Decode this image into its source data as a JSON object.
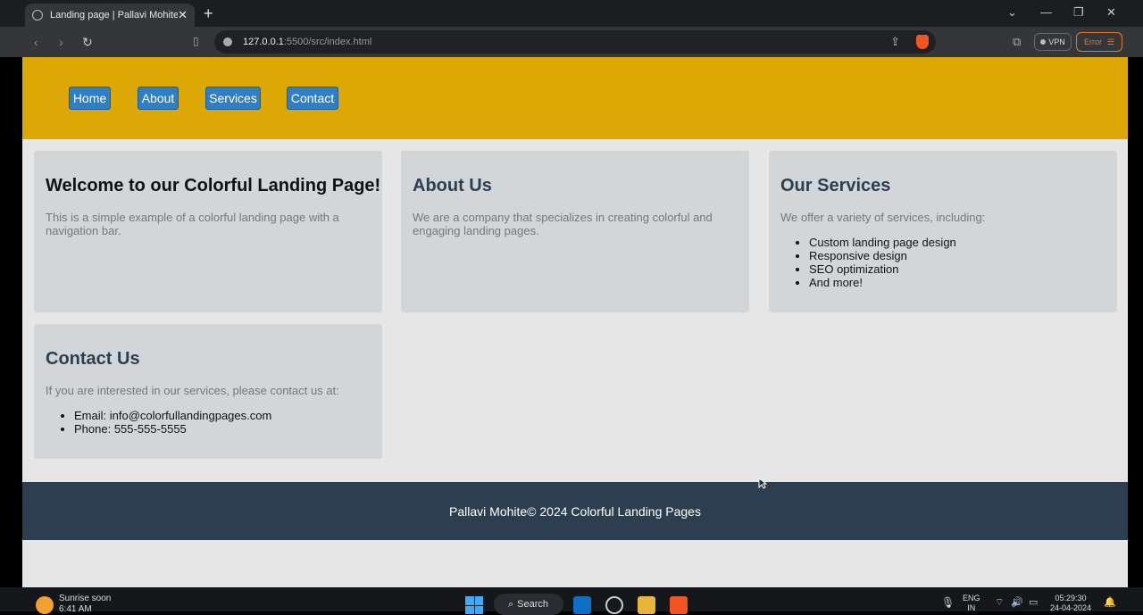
{
  "browser": {
    "tab_title": "Landing page | Pallavi Mohite",
    "url_host": "127.0.0.1",
    "url_rest": ":5500/src/index.html",
    "vpn_label": "VPN",
    "error_label": "Error"
  },
  "nav": {
    "items": [
      "Home",
      "About",
      "Services",
      "Contact"
    ]
  },
  "cards": {
    "welcome": {
      "title": "Welcome to our Colorful Landing Page!",
      "text": "This is a simple example of a colorful landing page with a navigation bar."
    },
    "about": {
      "title": "About Us",
      "text": "We are a company that specializes in creating colorful and engaging landing pages."
    },
    "services": {
      "title": "Our Services",
      "text": "We offer a variety of services, including:",
      "items": [
        "Custom landing page design",
        "Responsive design",
        "SEO optimization",
        "And more!"
      ]
    },
    "contact": {
      "title": "Contact Us",
      "text": "If you are interested in our services, please contact us at:",
      "items": [
        "Email: info@colorfullandingpages.com",
        "Phone: 555-555-5555"
      ]
    }
  },
  "footer": {
    "text": "Pallavi Mohite© 2024 Colorful Landing Pages"
  },
  "taskbar": {
    "weather_line1": "Sunrise soon",
    "weather_line2": "6:41 AM",
    "search_label": "Search",
    "lang_line1": "ENG",
    "lang_line2": "IN",
    "time": "05:29:30",
    "date": "24-04-2024"
  },
  "colors": {
    "header_bg": "#dda806",
    "nav_button": "#2f7fc2",
    "card_bg": "#d3d6d8",
    "footer_bg": "#2c3e50",
    "page_bg": "#e6e6e6"
  },
  "icons": [
    "globe-icon",
    "close-icon",
    "plus-icon",
    "back-icon",
    "forward-icon",
    "reload-icon",
    "bookmark-icon",
    "info-icon",
    "share-icon",
    "brave-icon",
    "extensions-icon",
    "menu-icon",
    "windows-start-icon",
    "search-icon",
    "vscode-icon",
    "chrome-icon",
    "folder-icon",
    "mic-icon",
    "wifi-icon",
    "volume-icon",
    "battery-icon",
    "bell-icon"
  ]
}
